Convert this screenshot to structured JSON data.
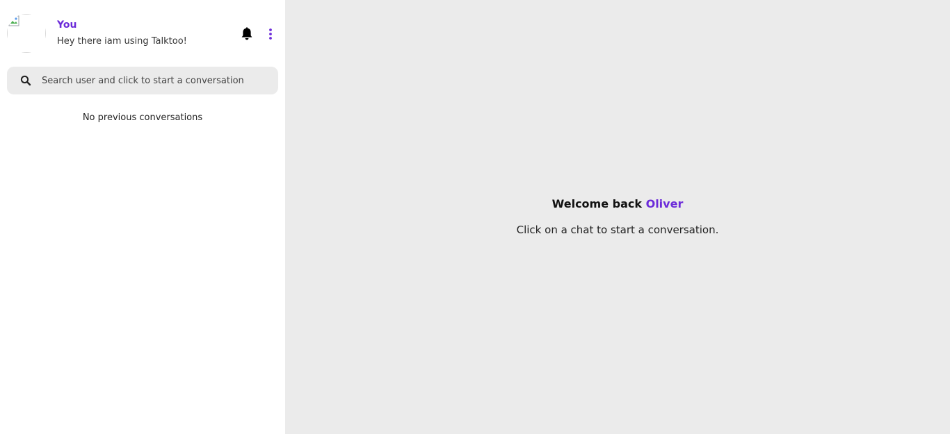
{
  "profile": {
    "name": "You",
    "status": "Hey there iam using Talktoo!",
    "avatar_icon": "broken-image-icon"
  },
  "header_actions": {
    "notification_icon": "bell-icon",
    "menu_icon": "more-vertical-icon"
  },
  "search": {
    "placeholder": "Search user and click to start a conversation",
    "value": "",
    "icon": "search-icon"
  },
  "conversations": {
    "empty_message": "No previous conversations"
  },
  "main": {
    "welcome_prefix": "Welcome back",
    "user_name": "Oliver",
    "subtitle": "Click on a chat to start a conversation."
  },
  "colors": {
    "accent": "#6c2bd9",
    "main_bg": "#ebebeb",
    "search_bg": "#ebebeb"
  }
}
